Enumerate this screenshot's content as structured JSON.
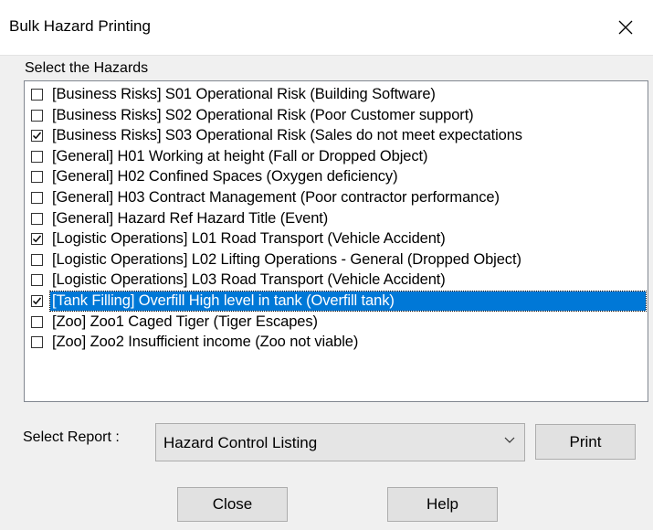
{
  "window": {
    "title": "Bulk Hazard Printing"
  },
  "hazards": {
    "label": "Select the Hazards",
    "items": [
      {
        "label": "[Business Risks] S01 Operational Risk (Building Software)",
        "checked": false,
        "selected": false
      },
      {
        "label": "[Business Risks] S02 Operational Risk (Poor Customer support)",
        "checked": false,
        "selected": false
      },
      {
        "label": "[Business Risks] S03 Operational Risk (Sales do not meet expectations",
        "checked": true,
        "selected": false
      },
      {
        "label": "[General] H01 Working at height (Fall or Dropped Object)",
        "checked": false,
        "selected": false
      },
      {
        "label": "[General] H02 Confined Spaces (Oxygen deficiency)",
        "checked": false,
        "selected": false
      },
      {
        "label": "[General] H03 Contract Management (Poor contractor performance)",
        "checked": false,
        "selected": false
      },
      {
        "label": "[General] Hazard Ref Hazard Title (Event)",
        "checked": false,
        "selected": false
      },
      {
        "label": "[Logistic Operations] L01 Road Transport (Vehicle Accident)",
        "checked": true,
        "selected": false
      },
      {
        "label": "[Logistic Operations] L02 Lifting Operations - General (Dropped Object)",
        "checked": false,
        "selected": false
      },
      {
        "label": "[Logistic Operations] L03 Road Transport (Vehicle Accident)",
        "checked": false,
        "selected": false
      },
      {
        "label": "[Tank Filling] Overfill High level in tank (Overfill tank)",
        "checked": true,
        "selected": true
      },
      {
        "label": "[Zoo] Zoo1 Caged Tiger (Tiger Escapes)",
        "checked": false,
        "selected": false
      },
      {
        "label": "[Zoo] Zoo2 Insufficient income (Zoo not viable)",
        "checked": false,
        "selected": false
      }
    ]
  },
  "report": {
    "label": "Select Report :",
    "selected": "Hazard Control Listing"
  },
  "buttons": {
    "print": "Print",
    "close": "Close",
    "help": "Help"
  },
  "colors": {
    "selection": "#0078d7",
    "background": "#f0f0f0"
  }
}
